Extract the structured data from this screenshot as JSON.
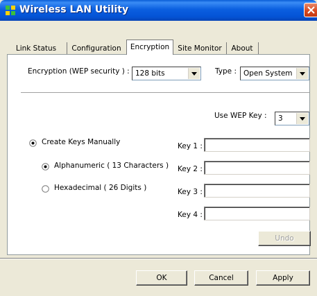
{
  "window": {
    "title": "Wireless LAN Utility",
    "app_icon": "wireless-grid-icon",
    "close_icon": "close-icon"
  },
  "tabs": [
    {
      "label": "Link Status",
      "active": false
    },
    {
      "label": "Configuration",
      "active": false
    },
    {
      "label": "Encryption",
      "active": true
    },
    {
      "label": "Site Monitor",
      "active": false
    },
    {
      "label": "About",
      "active": false
    }
  ],
  "encryption": {
    "label": "Encryption (WEP security ) :",
    "value": "128 bits",
    "type_label": "Type :",
    "type_value": "Open System"
  },
  "wep_key": {
    "label": "Use WEP Key :",
    "value": "3"
  },
  "mode": {
    "manual_label": "Create Keys Manually",
    "manual_selected": true,
    "alnum_label": "Alphanumeric ( 13 Characters )",
    "alnum_selected": true,
    "hex_label": "Hexadecimal ( 26 Digits )",
    "hex_selected": false
  },
  "keys": [
    {
      "label": "Key 1 :",
      "value": ""
    },
    {
      "label": "Key 2 :",
      "value": ""
    },
    {
      "label": "Key 3 :",
      "value": ""
    },
    {
      "label": "Key 4 :",
      "value": ""
    }
  ],
  "buttons": {
    "undo": "Undo",
    "ok": "OK",
    "cancel": "Cancel",
    "apply": "Apply"
  },
  "colors": {
    "titlebar": "#0453d6",
    "face": "#ece9d8",
    "close": "#d9491f"
  }
}
